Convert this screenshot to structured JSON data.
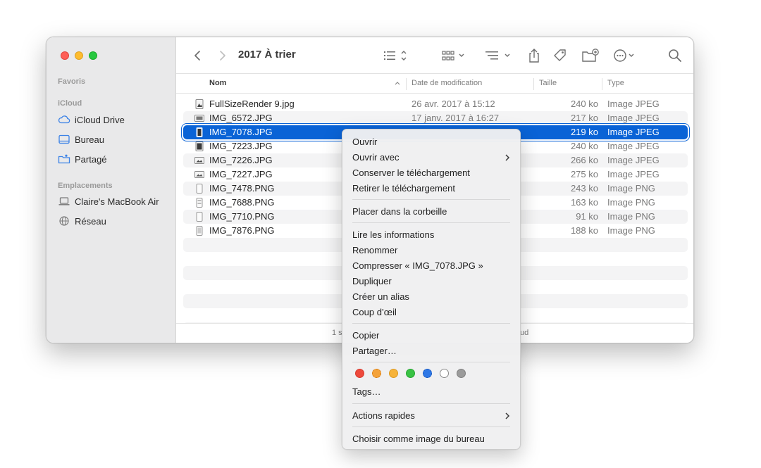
{
  "window": {
    "title": "2017 À trier"
  },
  "sidebar": {
    "sections": {
      "favoris": "Favoris",
      "icloud": "iCloud",
      "emplacements": "Emplacements"
    },
    "items": [
      {
        "label": "iCloud Drive",
        "icon": "cloud-icon"
      },
      {
        "label": "Bureau",
        "icon": "desktop-icon"
      },
      {
        "label": "Partagé",
        "icon": "shared-folder-icon"
      },
      {
        "label": "Claire's MacBook Air",
        "icon": "laptop-icon"
      },
      {
        "label": "Réseau",
        "icon": "globe-icon"
      }
    ]
  },
  "columns": {
    "name": "Nom",
    "date": "Date de modification",
    "size": "Taille",
    "type": "Type"
  },
  "files": [
    {
      "name": "FullSizeRender 9.jpg",
      "date": "26 avr. 2017 à 15:12",
      "size": "240 ko",
      "type": "Image JPEG"
    },
    {
      "name": "IMG_6572.JPG",
      "date": "17 janv. 2017 à 16:27",
      "size": "217 ko",
      "type": "Image JPEG"
    },
    {
      "name": "IMG_7078.JPG",
      "date": "",
      "size": "219 ko",
      "type": "Image JPEG",
      "selected": true
    },
    {
      "name": "IMG_7223.JPG",
      "date": "",
      "size": "240 ko",
      "type": "Image JPEG"
    },
    {
      "name": "IMG_7226.JPG",
      "date": "",
      "size": "266 ko",
      "type": "Image JPEG"
    },
    {
      "name": "IMG_7227.JPG",
      "date": "",
      "size": "275 ko",
      "type": "Image JPEG"
    },
    {
      "name": "IMG_7478.PNG",
      "date": "",
      "size": "243 ko",
      "type": "Image PNG"
    },
    {
      "name": "IMG_7688.PNG",
      "date": "",
      "size": "163 ko",
      "type": "Image PNG"
    },
    {
      "name": "IMG_7710.PNG",
      "date": "",
      "size": "91 ko",
      "type": "Image PNG"
    },
    {
      "name": "IMG_7876.PNG",
      "date": "",
      "size": "188 ko",
      "type": "Image PNG"
    }
  ],
  "statusbar": {
    "left": "1 s",
    "right": "ud"
  },
  "context_menu": {
    "open": "Ouvrir",
    "open_with": "Ouvrir avec",
    "keep_download": "Conserver le téléchargement",
    "remove_download": "Retirer le téléchargement",
    "trash": "Placer dans la corbeille",
    "get_info": "Lire les informations",
    "rename": "Renommer",
    "compress": "Compresser « IMG_7078.JPG »",
    "duplicate": "Dupliquer",
    "make_alias": "Créer un alias",
    "quick_look": "Coup d’œil",
    "copy": "Copier",
    "share": "Partager…",
    "tags": "Tags…",
    "quick_actions": "Actions rapides",
    "set_desktop": "Choisir comme image du bureau"
  },
  "tag_colors": [
    "#ee4a3c",
    "#f4a23a",
    "#f6b33a",
    "#39c244",
    "#2f78e6",
    "#ffffff",
    "#9b9b9b"
  ],
  "accent": "#0a63d6"
}
